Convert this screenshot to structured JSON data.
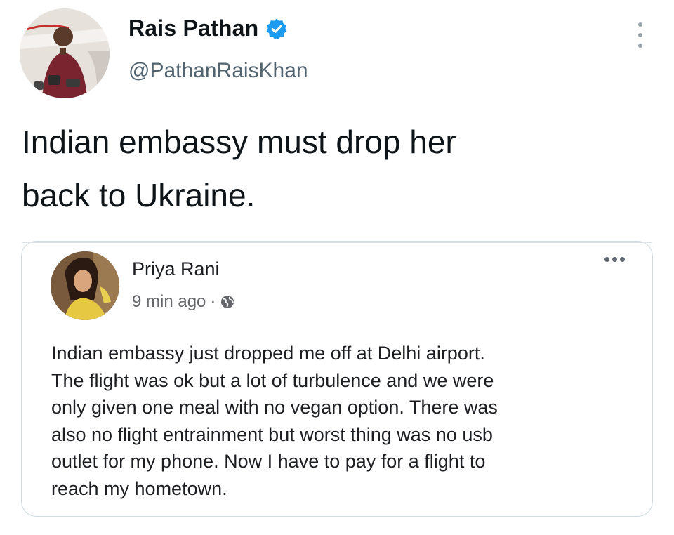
{
  "tweet": {
    "author": {
      "name": "Rais Pathan",
      "handle": "@PathanRaisKhan",
      "verified": true,
      "avatar_icon": "profile-photo-speaker"
    },
    "text_line1": "Indian embassy must drop her",
    "text_line2": "back to Ukraine.",
    "more_icon": "vertical-ellipsis"
  },
  "quoted_post": {
    "author": {
      "name": "Priya Rani",
      "avatar_icon": "profile-photo-woman"
    },
    "time": "9 min ago",
    "separator": "·",
    "audience_icon": "globe-icon",
    "more_icon": "horizontal-ellipsis",
    "text_lines": [
      "Indian embassy just dropped me off at Delhi airport.",
      "The flight was ok but a lot of turbulence and we were",
      "only given one meal with no vegan option. There was",
      "also no flight entrainment but worst thing was no usb",
      "outlet for my phone. Now I have to pay for a flight to",
      "reach my hometown."
    ]
  },
  "colors": {
    "verified_badge": "#1d9bf0",
    "handle_gray": "#536471",
    "card_border": "#cfd9de",
    "facebook_meta_gray": "#65676b"
  }
}
